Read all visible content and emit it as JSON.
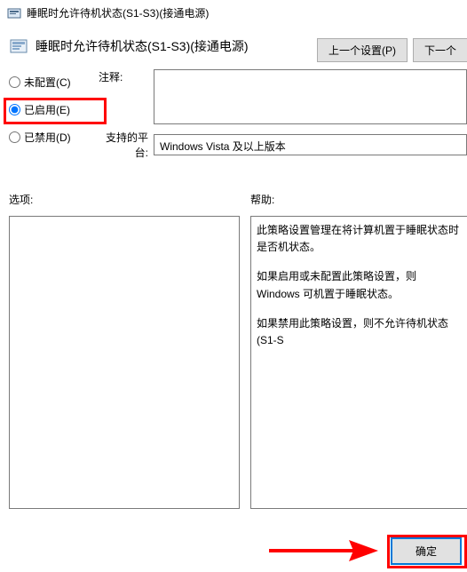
{
  "titlebar": {
    "title": "睡眠时允许待机状态(S1-S3)(接通电源)"
  },
  "subtitle": {
    "text": "睡眠时允许待机状态(S1-S3)(接通电源)"
  },
  "buttons": {
    "prev": "上一个设置(P)",
    "next": "下一个",
    "ok": "确定"
  },
  "radios": {
    "not_configured": "未配置(C)",
    "enabled": "已启用(E)",
    "disabled": "已禁用(D)"
  },
  "labels": {
    "comment": "注释:",
    "platform": "支持的平台:",
    "options": "选项:",
    "help": "帮助:"
  },
  "platform_text": "Windows Vista 及以上版本",
  "help": {
    "p1": "此策略设置管理在将计算机置于睡眠状态时是否机状态。",
    "p2": "如果启用或未配置此策略设置，则 Windows 可机置于睡眠状态。",
    "p3": "如果禁用此策略设置，则不允许待机状态(S1-S"
  }
}
